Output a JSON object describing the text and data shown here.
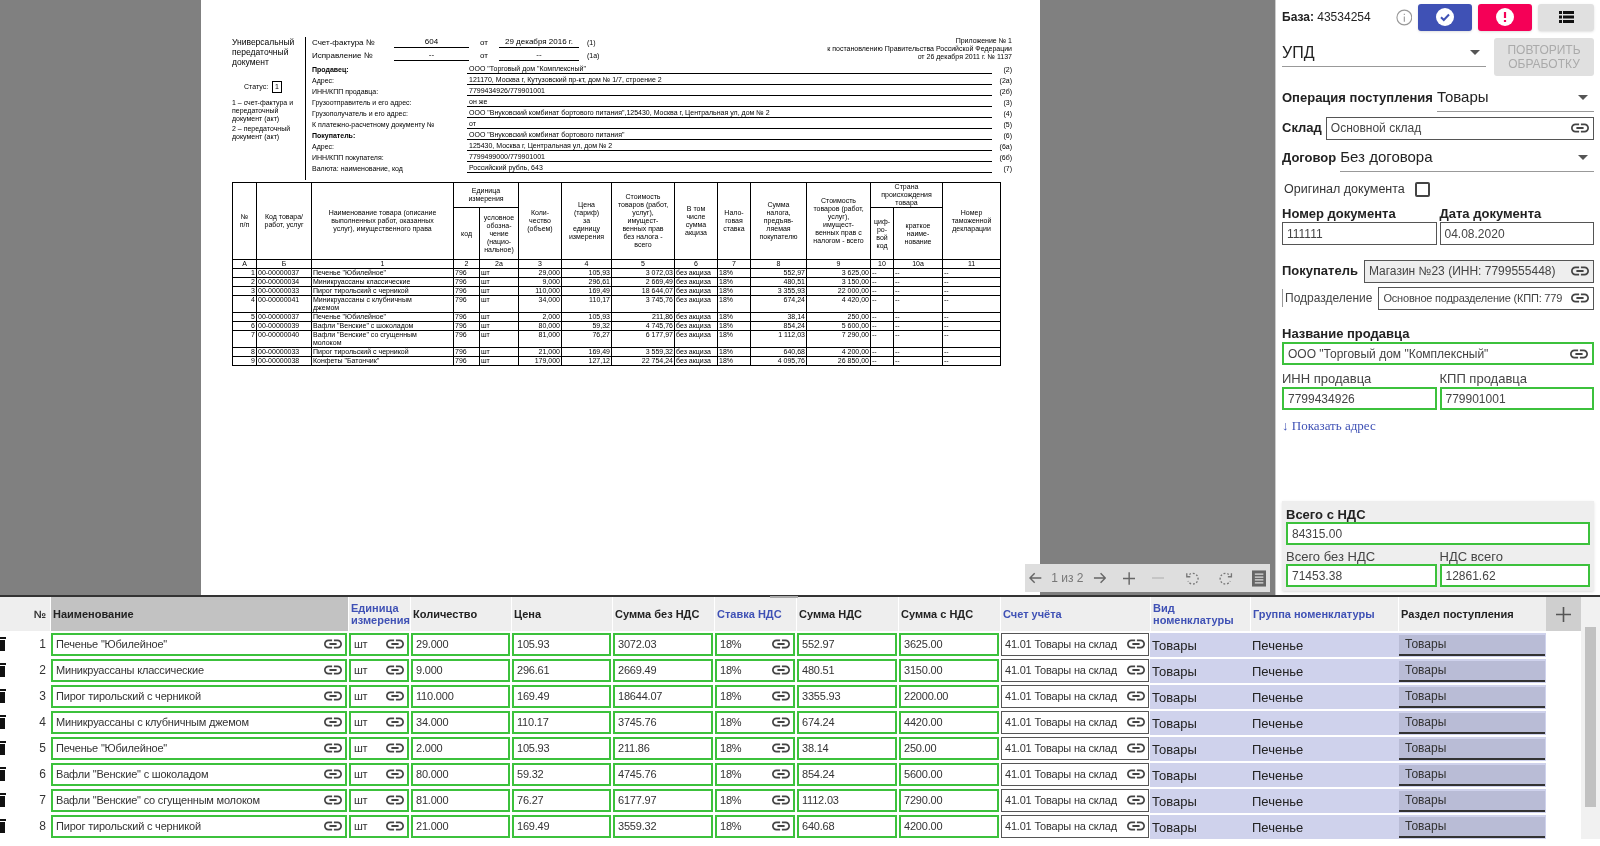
{
  "viewer": {
    "document": {
      "title": "Универсальный передаточный документ",
      "status_label": "Статус:",
      "status_value": "1",
      "status_notes": [
        "1 – счет-фактура и передаточный документ (акт)",
        "2 – передаточный документ (акт)"
      ],
      "invoice": {
        "label": "Счет-фактура №",
        "number": "604",
        "from": "от",
        "date": "29 декабря 2016 г.",
        "code": "(1)"
      },
      "correction": {
        "label": "Исправление №",
        "number": "--",
        "from": "от",
        "date": "--",
        "code": "(1а)"
      },
      "appendix": [
        "Приложение № 1",
        "к постановлению Правительства Российской Федерации",
        "от 26 декабря 2011 г. № 1137"
      ],
      "fields": [
        {
          "label": "Продавец:",
          "value": "ООО \"Торговый дом \"Комплексный\"",
          "code": "(2)",
          "bold": true
        },
        {
          "label": "Адрес:",
          "value": "121170, Москва г, Кутузовский пр-кт, дом № 1/7, строение 2",
          "code": "(2а)",
          "bold": false
        },
        {
          "label": "ИНН/КПП продавца:",
          "value": "7799434926/779901001",
          "code": "(2б)",
          "bold": false
        },
        {
          "label": "Грузоотправитель и его адрес:",
          "value": "он же",
          "code": "(3)",
          "bold": false
        },
        {
          "label": "Грузополучатель и его адрес:",
          "value": "ООО \"Внуковский комбинат бортового питания\",125430, Москва г, Центральная ул, дом № 2",
          "code": "(4)",
          "bold": false
        },
        {
          "label": "К платежно-расчетному документу №",
          "value": "от",
          "code": "(5)",
          "bold": false
        },
        {
          "label": "Покупатель:",
          "value": "ООО \"Внуковский комбинат бортового питания\"",
          "code": "(6)",
          "bold": true
        },
        {
          "label": "Адрес:",
          "value": "125430, Москва г, Центральная ул, дом № 2",
          "code": "(6а)",
          "bold": false
        },
        {
          "label": "ИНН/КПП покупателя:",
          "value": "7799499000/779901001",
          "code": "(6б)",
          "bold": false
        },
        {
          "label": "Валюта: наименование, код",
          "value": "Российский рубль, 643",
          "code": "(7)",
          "bold": false
        }
      ],
      "table": {
        "head": [
          {
            "label": "№\nп/п"
          },
          {
            "label": "Код товара/\nработ, услуг"
          },
          {
            "label": "Наименование товара (описание\nвыполненных работ, оказанных\nуслуг), имущественного права"
          },
          {
            "label": "Единица\nизмерения",
            "sub": [
              "код",
              "условное\nобозна-\nчение\n(нацио-\nнальное)"
            ]
          },
          {
            "label": "Коли-\nчество\n(объем)"
          },
          {
            "label": "Цена\n(тариф)\nза\nединицу\nизмерения"
          },
          {
            "label": "Стоимость\nтоваров (работ,\nуслуг),\nимущест-\nвенных прав\nбез налога -\nвсего"
          },
          {
            "label": "В том\nчисле\nсумма\nакциза"
          },
          {
            "label": "Нало-\nговая\nставка"
          },
          {
            "label": "Сумма\nналога,\nпредъяв-\nляемая\nпокупателю"
          },
          {
            "label": "Стоимость\nтоваров (работ,\nуслуг),\nимущест-\nвенных прав с\nналогом - всего"
          },
          {
            "label": "Страна\nпроисхождения\nтовара",
            "sub": [
              "циф-\nро-\nвой\nкод",
              "краткое\nнаиме-\nнование"
            ]
          },
          {
            "label": "Номер\nтаможенной\nдекларации"
          }
        ],
        "numbers": [
          "А",
          "Б",
          "1",
          "2",
          "2а",
          "3",
          "4",
          "5",
          "6",
          "7",
          "8",
          "9",
          "10",
          "10а",
          "11"
        ],
        "rows": [
          [
            "1",
            "00-00000037",
            "Печенье \"Юбилейное\"",
            "796",
            "шт",
            "29,000",
            "105,93",
            "3 072,03",
            "без акциза",
            "18%",
            "552,97",
            "3 625,00",
            "--",
            "--",
            "--"
          ],
          [
            "2",
            "00-00000034",
            "Миникруассаны классические",
            "796",
            "шт",
            "9,000",
            "296,61",
            "2 669,49",
            "без акциза",
            "18%",
            "480,51",
            "3 150,00",
            "--",
            "--",
            "--"
          ],
          [
            "3",
            "00-00000033",
            "Пирог тирольский с черникой",
            "796",
            "шт",
            "110,000",
            "169,49",
            "18 644,07",
            "без акциза",
            "18%",
            "3 355,93",
            "22 000,00",
            "--",
            "--",
            "--"
          ],
          [
            "4",
            "00-00000041",
            "Миникруассаны с клубничным\nджемом",
            "796",
            "шт",
            "34,000",
            "110,17",
            "3 745,76",
            "без акциза",
            "18%",
            "674,24",
            "4 420,00",
            "--",
            "--",
            "--"
          ],
          [
            "5",
            "00-00000037",
            "Печенье \"Юбилейное\"",
            "796",
            "шт",
            "2,000",
            "105,93",
            "211,86",
            "без акциза",
            "18%",
            "38,14",
            "250,00",
            "--",
            "--",
            "--"
          ],
          [
            "6",
            "00-00000039",
            "Вафли \"Венские\" с шоколадом",
            "796",
            "шт",
            "80,000",
            "59,32",
            "4 745,76",
            "без акциза",
            "18%",
            "854,24",
            "5 600,00",
            "--",
            "--",
            "--"
          ],
          [
            "7",
            "00-00000040",
            "Вафли \"Венские\" со сгущенным\nмолоком",
            "796",
            "шт",
            "81,000",
            "76,27",
            "6 177,97",
            "без акциза",
            "18%",
            "1 112,03",
            "7 290,00",
            "--",
            "--",
            "--"
          ],
          [
            "8",
            "00-00000033",
            "Пирог тирольский с черникой",
            "796",
            "шт",
            "21,000",
            "169,49",
            "3 559,32",
            "без акциза",
            "18%",
            "640,68",
            "4 200,00",
            "--",
            "--",
            "--"
          ],
          [
            "9",
            "00-00000038",
            "Конфеты \"Батончик\"",
            "796",
            "шт",
            "179,000",
            "127,12",
            "22 754,24",
            "без акциза",
            "18%",
            "4 095,76",
            "26 850,00",
            "--",
            "--",
            "--"
          ]
        ]
      }
    },
    "toolbar": {
      "page": "1 из 2"
    }
  },
  "sidebar": {
    "base": "**База:** 43534254",
    "doc_type": "УПД",
    "reprocess_button": {
      "label": "ПОВТОРИТЬ ОБРАБОТКУ",
      "disabled": true
    },
    "operation": {
      "label": "Операция поступления",
      "value": "Товары"
    },
    "warehouse": {
      "label": "Склад",
      "value": "Основной склад",
      "validated": false
    },
    "contract": {
      "label": "Договор",
      "value": "Без договора"
    },
    "original": {
      "label": "Оригинал документа",
      "checked": false
    },
    "doc_number": {
      "label": "Номер документа",
      "value": "111111",
      "validated": false
    },
    "doc_date": {
      "label": "Дата документа",
      "value": "04.08.2020",
      "validated": false
    },
    "buyer": {
      "label": "Покупатель",
      "value": "Магазин №23 (ИНН: 7799555448)",
      "validated": false
    },
    "subdivision": {
      "label": "Подразделение",
      "value": "Основное подразделение (КПП: 779",
      "validated": false
    },
    "seller_name": {
      "label": "Название продавца",
      "value": "ООО \"Торговый дом \"Комплексный\"",
      "validated": true
    },
    "seller_inn": {
      "label": "ИНН продавца",
      "value": "7799434926",
      "validated": true
    },
    "seller_kpp": {
      "label": "КПП продавца",
      "value": "779901001",
      "validated": true
    },
    "show_address": "↓ Показать адрес",
    "totals": {
      "with_vat": {
        "label": "Всего с НДС",
        "value": "84315.00",
        "validated": true
      },
      "without_vat": {
        "label": "Всего без НДС",
        "value": "71453.38",
        "validated": true
      },
      "vat": {
        "label": "НДС всего",
        "value": "12861.62",
        "validated": true
      }
    }
  },
  "items_table": {
    "number_heading": "№",
    "columns": [
      {
        "label": "Наименование",
        "kind": "ref_field",
        "linked": false,
        "validated": true,
        "selected": true
      },
      {
        "label": "Единица измерения",
        "kind": "ref_field",
        "linked": true,
        "validated": true,
        "selected": false
      },
      {
        "label": "Количество",
        "kind": "field",
        "linked": false,
        "validated": true,
        "selected": false
      },
      {
        "label": "Цена",
        "kind": "field",
        "linked": false,
        "validated": true,
        "selected": false
      },
      {
        "label": "Сумма без НДС",
        "kind": "field",
        "linked": false,
        "validated": true,
        "selected": false
      },
      {
        "label": "Ставка НДС",
        "kind": "ref_field",
        "linked": true,
        "validated": true,
        "selected": false
      },
      {
        "label": "Сумма НДС",
        "kind": "field",
        "linked": false,
        "validated": true,
        "selected": false
      },
      {
        "label": "Сумма с НДС",
        "kind": "field",
        "linked": false,
        "validated": true,
        "selected": false
      },
      {
        "label": "Счет учёта",
        "kind": "ref_field",
        "linked": true,
        "validated": false,
        "selected": false
      },
      {
        "label": "Вид номенклатуры",
        "kind": "static",
        "linked": true,
        "selected": false
      },
      {
        "label": "Группа номенклатуры",
        "kind": "static",
        "linked": true,
        "selected": false
      },
      {
        "label": "Раздел поступления",
        "kind": "select",
        "linked": false,
        "selected": false
      }
    ],
    "rows": [
      {
        "number": "1",
        "cells": [
          "Печенье \"Юбилейное\"",
          "шт",
          "29.000",
          "105.93",
          "3072.03",
          "18%",
          "552.97",
          "3625.00",
          "41.01 Товары на склад",
          "Товары",
          "Печенье",
          "Товары"
        ]
      },
      {
        "number": "2",
        "cells": [
          "Миникруассаны классические",
          "шт",
          "9.000",
          "296.61",
          "2669.49",
          "18%",
          "480.51",
          "3150.00",
          "41.01 Товары на склад",
          "Товары",
          "Печенье",
          "Товары"
        ]
      },
      {
        "number": "3",
        "cells": [
          "Пирог тирольский с черникой",
          "шт",
          "110.000",
          "169.49",
          "18644.07",
          "18%",
          "3355.93",
          "22000.00",
          "41.01 Товары на склад",
          "Товары",
          "Печенье",
          "Товары"
        ]
      },
      {
        "number": "4",
        "cells": [
          "Миникруассаны с клубничным джемом",
          "шт",
          "34.000",
          "110.17",
          "3745.76",
          "18%",
          "674.24",
          "4420.00",
          "41.01 Товары на склад",
          "Товары",
          "Печенье",
          "Товары"
        ]
      },
      {
        "number": "5",
        "cells": [
          "Печенье \"Юбилейное\"",
          "шт",
          "2.000",
          "105.93",
          "211.86",
          "18%",
          "38.14",
          "250.00",
          "41.01 Товары на склад",
          "Товары",
          "Печенье",
          "Товары"
        ]
      },
      {
        "number": "6",
        "cells": [
          "Вафли \"Венские\" с шоколадом",
          "шт",
          "80.000",
          "59.32",
          "4745.76",
          "18%",
          "854.24",
          "5600.00",
          "41.01 Товары на склад",
          "Товары",
          "Печенье",
          "Товары"
        ]
      },
      {
        "number": "7",
        "cells": [
          "Вафли \"Венские\" со сгущенным молоком",
          "шт",
          "81.000",
          "76.27",
          "6177.97",
          "18%",
          "1112.03",
          "7290.00",
          "41.01 Товары на склад",
          "Товары",
          "Печенье",
          "Товары"
        ]
      },
      {
        "number": "8",
        "cells": [
          "Пирог тирольский с черникой",
          "шт",
          "21.000",
          "169.49",
          "3559.32",
          "18%",
          "640.68",
          "4200.00",
          "41.01 Товары на склад",
          "Товары",
          "Печенье",
          "Товары"
        ]
      }
    ]
  }
}
